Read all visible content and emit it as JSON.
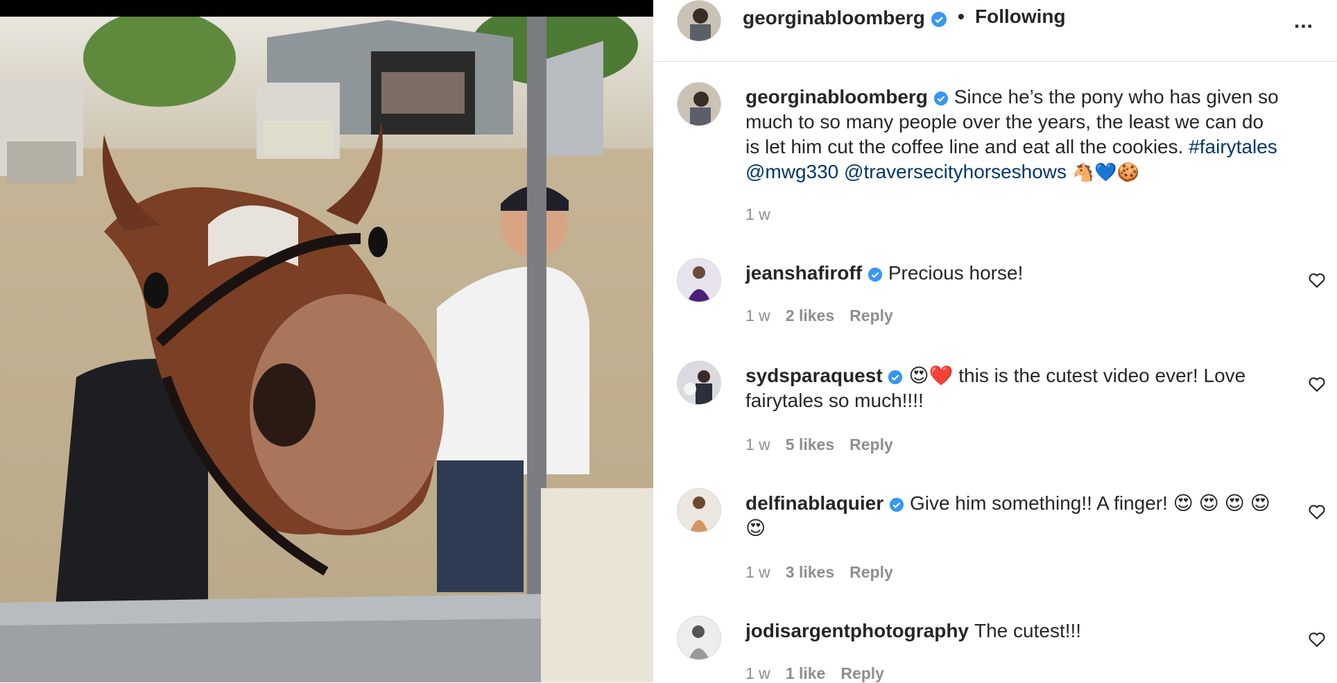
{
  "post": {
    "username": "georginabloomberg",
    "separator": "•",
    "follow_status": "Following",
    "more": "...",
    "caption_text": "Since he’s the pony who has given so much to so many people over the years, the least we can do is let him cut the coffee line and eat all the cookies.",
    "hashtag": "#fairytales",
    "mention1": "@mwg330",
    "mention2": "@traversecityhorseshows",
    "emojis": "🐴💙🍪",
    "time": "1 w"
  },
  "comments": [
    {
      "username": "jeanshafiroff",
      "text": "Precious horse!",
      "time": "1 w",
      "likes": "2 likes",
      "reply": "Reply"
    },
    {
      "username": "sydsparaquest",
      "text": "😍❤️ this is the cutest video ever! Love fairytales so much!!!!",
      "time": "1 w",
      "likes": "5 likes",
      "reply": "Reply"
    },
    {
      "username": "delfinablaquier",
      "text": "Give him something!! A finger! 😍 😍 😍 😍 😍",
      "time": "1 w",
      "likes": "3 likes",
      "reply": "Reply"
    },
    {
      "username": "jodisargentphotography",
      "text": "The cutest!!!",
      "time": "1 w",
      "likes": "1 like",
      "reply": "Reply"
    }
  ],
  "colors": {
    "verified": "#3897f0",
    "link": "#00376b",
    "muted": "#8e8e8e",
    "text": "#262626"
  },
  "icons": {
    "heart": "heart-outline-icon",
    "verified": "verified-badge-icon",
    "more": "more-options-icon"
  }
}
